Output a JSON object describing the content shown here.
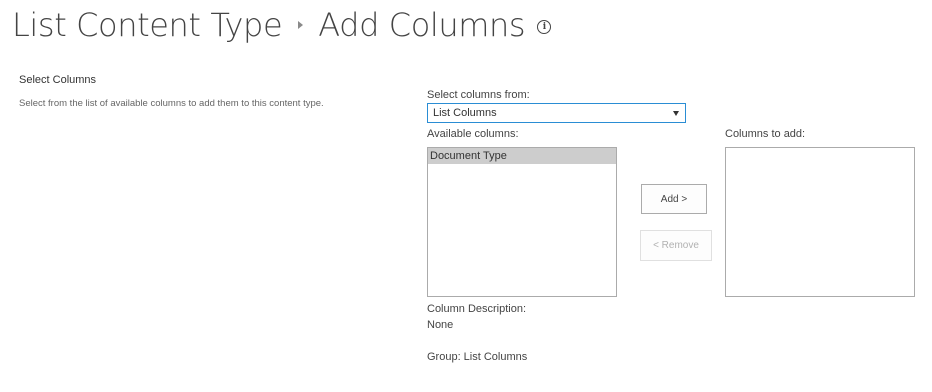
{
  "header": {
    "breadcrumb_parent": "List Content Type",
    "page_title": "Add Columns",
    "info_icon_glyph": "i"
  },
  "section": {
    "title": "Select Columns",
    "description": "Select from the list of available columns to add them to this content type."
  },
  "source": {
    "label": "Select columns from:",
    "selected_value": "List Columns"
  },
  "available": {
    "label": "Available columns:",
    "items": [
      {
        "label": "Document Type",
        "selected": true
      }
    ]
  },
  "to_add": {
    "label": "Columns to add:",
    "items": []
  },
  "buttons": {
    "add_label": "Add >",
    "remove_label": "< Remove"
  },
  "details": {
    "description_label": "Column Description:",
    "description_value": "None",
    "group_text": "Group: List Columns"
  },
  "colors": {
    "focus_border": "#2a8dd4",
    "selected_item_bg": "#cdcdcd",
    "text": "#444444"
  }
}
